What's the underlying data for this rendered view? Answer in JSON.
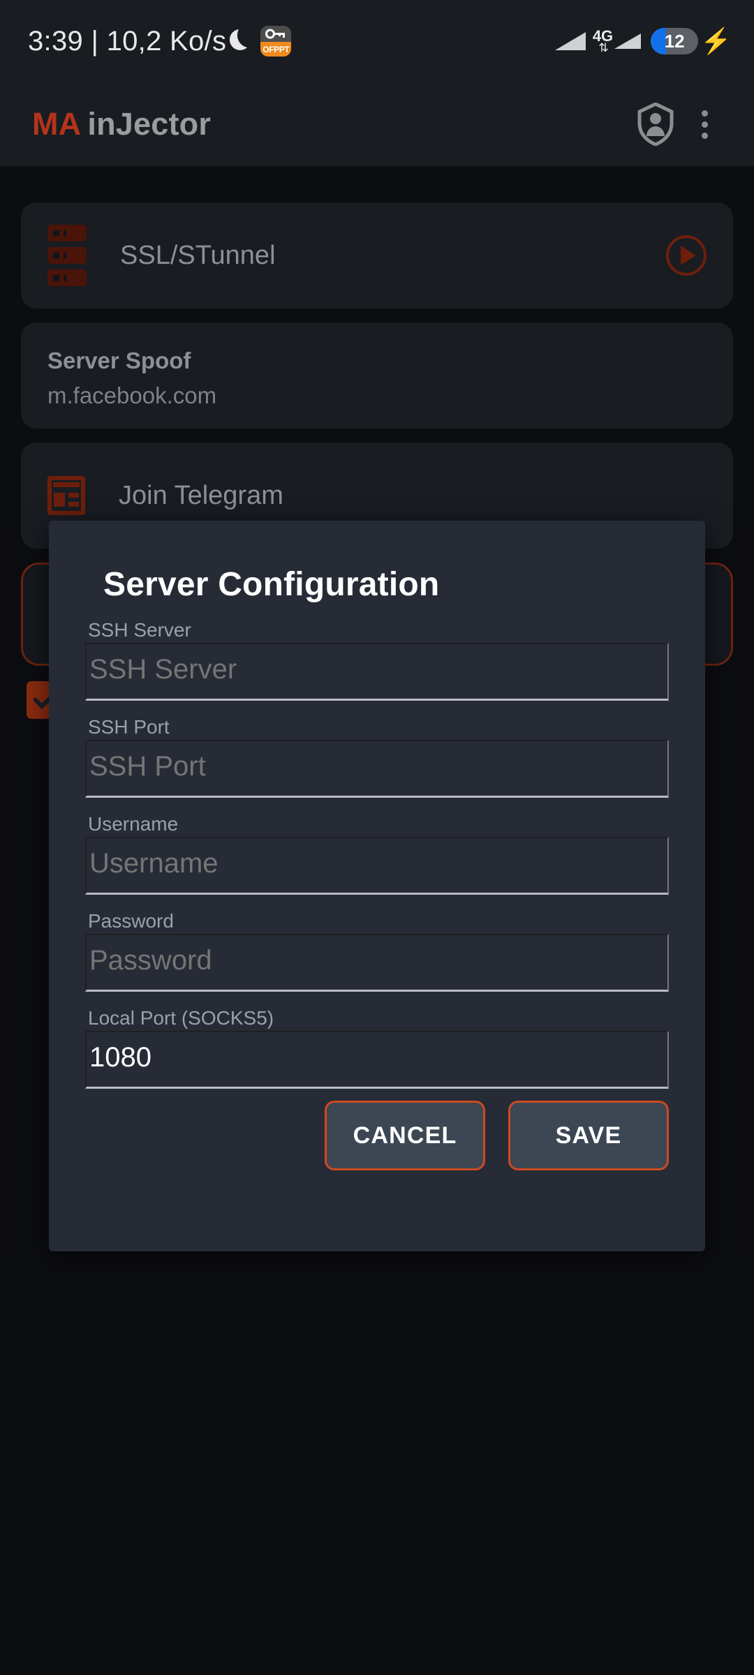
{
  "status_bar": {
    "clock": "3:39 | 10,2 Ko/s",
    "moon_icon": "moon-icon",
    "app_badge": {
      "icon": "ofppt-app-icon",
      "label": "OFPPT"
    },
    "signal_icon": "signal-bars-icon",
    "signal_icon_2": "signal-bars-secondary-icon",
    "network_type": "4G",
    "data_arrows": "⇅",
    "battery_percent": "12",
    "charging_icon": "lightning-bolt-icon"
  },
  "app_bar": {
    "title_accent": "MA",
    "title_rest": "inJector",
    "shield_icon": "shield-account-icon",
    "overflow_icon": "three-dot-menu-icon"
  },
  "content": {
    "ssl_card": {
      "icon": "server-stack-icon",
      "label": "SSL/STunnel",
      "action_icon": "play-circle-icon"
    },
    "spoof_card": {
      "title": "Server Spoof",
      "value": "m.facebook.com"
    },
    "telegram_card": {
      "icon": "news-article-icon",
      "label": "Join Telegram"
    },
    "checkbox": {
      "icon": "checkmark-icon",
      "checked": true
    }
  },
  "dialog": {
    "title": "Server Configuration",
    "fields": [
      {
        "label": "SSH Server",
        "value": "",
        "placeholder": "SSH Server"
      },
      {
        "label": "SSH Port",
        "value": "",
        "placeholder": "SSH Port"
      },
      {
        "label": "Username",
        "value": "",
        "placeholder": "Username"
      },
      {
        "label": "Password",
        "value": "",
        "placeholder": "Password"
      },
      {
        "label": "Local Port (SOCKS5)",
        "value": "1080",
        "placeholder": "Local Port"
      }
    ],
    "cancel_label": "CANCEL",
    "save_label": "SAVE"
  },
  "colors": {
    "accent_orange": "#cd4a22",
    "brand_red": "#b4341b",
    "dark_red": "#6d1f0c",
    "dialog_bg": "#272b36",
    "card_bg": "#191c21",
    "screen_bg": "#0c0d10",
    "button_fill": "#3c4753",
    "battery_blue": "#1470e8"
  }
}
